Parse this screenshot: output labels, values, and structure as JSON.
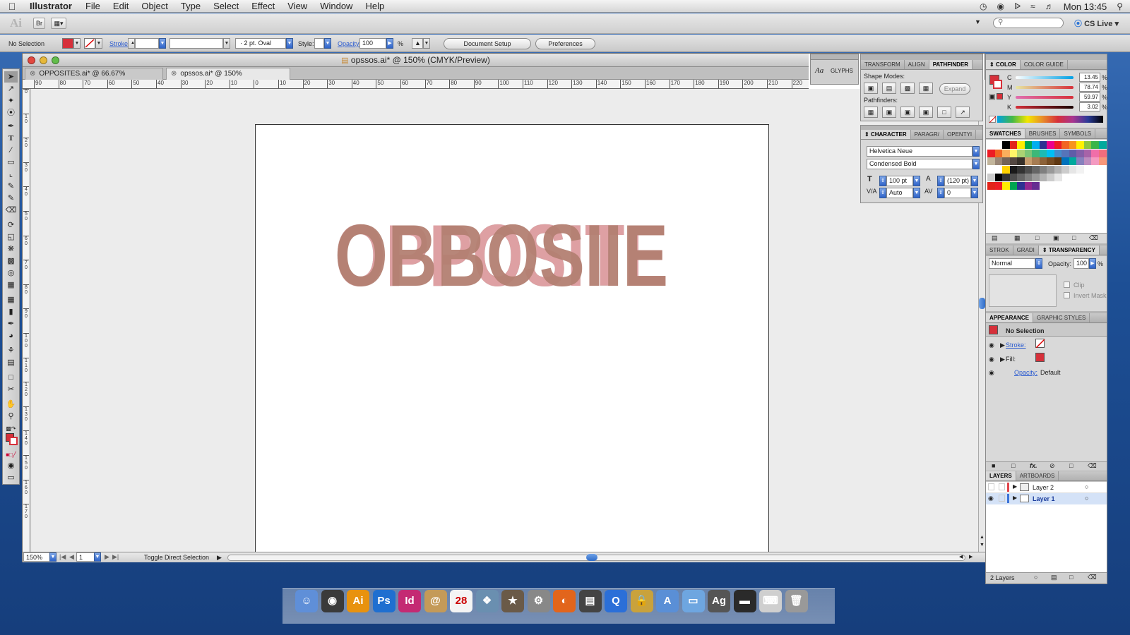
{
  "menubar": {
    "app_name": "Illustrator",
    "menus": [
      "File",
      "Edit",
      "Object",
      "Type",
      "Select",
      "Effect",
      "View",
      "Window",
      "Help"
    ],
    "clock": "Mon 13:45"
  },
  "appbar": {
    "logo": "Ai",
    "bridge_label": "Br",
    "search_placeholder": "",
    "cs_live": "CS Live"
  },
  "control": {
    "selection": "No Selection",
    "stroke_label": "Stroke:",
    "brush": "2 pt. Oval",
    "style_label": "Style:",
    "opacity_label": "Opacity:",
    "opacity_value": "100",
    "percent": "%",
    "doc_setup": "Document Setup",
    "preferences": "Preferences"
  },
  "document": {
    "window_title": "opssos.ai* @ 150% (CMYK/Preview)",
    "tabs": [
      {
        "label": "OPPOSITES.ai* @ 66.67% (CMYK/Preview)"
      },
      {
        "label": "opssos.ai* @ 150% (CMYK/Preview)"
      }
    ],
    "hruler_labels": [
      "90",
      "80",
      "70",
      "60",
      "50",
      "40",
      "30",
      "20",
      "10",
      "0",
      "10",
      "20",
      "30",
      "40",
      "50",
      "60",
      "70",
      "80",
      "90",
      "100",
      "110",
      "120",
      "130",
      "140",
      "150",
      "160",
      "170",
      "180",
      "190",
      "200",
      "210",
      "220"
    ],
    "vruler_labels": [
      "0",
      "1 0",
      "2 0",
      "3 0",
      "4 0",
      "5 0",
      "6 0",
      "7 0",
      "8 0",
      "9 0",
      "1 0 0",
      "1 1 0",
      "1 2 0",
      "1 3 0",
      "1 4 0",
      "1 5 0",
      "1 6 0",
      "1 7 0"
    ],
    "zoom": "150%",
    "artboard_number": "1",
    "status_text": "Toggle Direct Selection",
    "art_text_back": "OPPOSITE",
    "art_text_front": "OBBOSIIE",
    "art_colors": {
      "front": "#b38072",
      "back_green": "#8ec4b0",
      "back_pink": "#eb9aa0"
    }
  },
  "panels": {
    "glyphs": "GLYPHS",
    "pathfinder": {
      "tabs": [
        "TRANSFORM",
        "ALIGN",
        "PATHFINDER"
      ],
      "shape_modes": "Shape Modes:",
      "expand": "Expand",
      "pathfinders": "Pathfinders:"
    },
    "character": {
      "tabs": [
        "CHARACTER",
        "PARAGR/",
        "OPENTYI"
      ],
      "font_family": "Helvetica Neue",
      "font_style": "Condensed Bold",
      "size": "100 pt",
      "leading": "(120 pt)",
      "kerning": "Auto",
      "tracking": "0"
    },
    "color": {
      "tabs": [
        "COLOR",
        "COLOR GUIDE"
      ],
      "channels": [
        {
          "label": "C",
          "value": "13.45",
          "pct": 13.45
        },
        {
          "label": "M",
          "value": "78.74",
          "pct": 78.74
        },
        {
          "label": "Y",
          "value": "59.97",
          "pct": 59.97
        },
        {
          "label": "K",
          "value": "3.02",
          "pct": 3.02
        }
      ],
      "percent": "%",
      "fill_color": "#d6303a"
    },
    "swatches": {
      "tabs": [
        "SWATCHES",
        "BRUSHES",
        "SYMBOLS"
      ]
    },
    "transparency": {
      "tabs": [
        "STROK",
        "GRADI",
        "TRANSPARENCY"
      ],
      "mode": "Normal",
      "opacity_label": "Opacity:",
      "opacity": "100",
      "percent": "%",
      "clip": "Clip",
      "invert_mask": "Invert Mask"
    },
    "appearance": {
      "tabs": [
        "APPEARANCE",
        "GRAPHIC STYLES"
      ],
      "title": "No Selection",
      "stroke": "Stroke:",
      "fill": "Fill:",
      "opacity": "Opacity:",
      "opacity_value": "Default"
    },
    "layers": {
      "tabs": [
        "LAYERS",
        "ARTBOARDS"
      ],
      "items": [
        "Layer 2",
        "Layer 1"
      ],
      "count": "2 Layers"
    }
  },
  "dock": {
    "apps": [
      "Finder",
      "Dashboard",
      "Ai",
      "Ps",
      "Id",
      "Address Book",
      "28",
      "Photos",
      "iMovie",
      "System Preferences",
      "Firefox",
      "Clapper",
      "QuickTime",
      "Lock",
      "Applications",
      "Documents",
      "Ag",
      "Screen",
      "Keyboard",
      "Trash"
    ]
  }
}
